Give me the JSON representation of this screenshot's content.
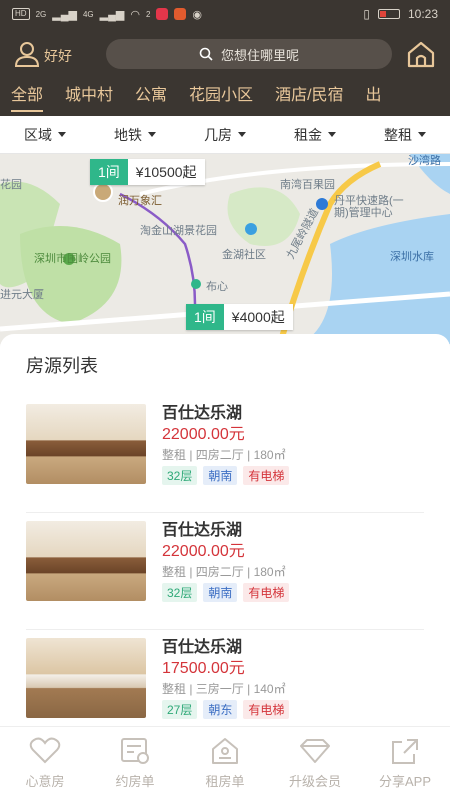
{
  "status_bar": {
    "left_chips": [
      "HD",
      "2G",
      "4G"
    ],
    "notification_count": "2",
    "time": "10:23"
  },
  "header": {
    "username": "好好",
    "search_placeholder": "您想住哪里呢",
    "icons": {
      "user": "user-icon",
      "search": "search-icon",
      "home": "home-icon"
    },
    "accent_color": "#e8c79a",
    "bg_color": "#3b3631"
  },
  "category_tabs": [
    {
      "label": "全部",
      "active": true
    },
    {
      "label": "城中村"
    },
    {
      "label": "公寓"
    },
    {
      "label": "花园小区"
    },
    {
      "label": "酒店/民宿"
    },
    {
      "label": "出"
    }
  ],
  "filters": [
    {
      "label": "区域"
    },
    {
      "label": "地铁"
    },
    {
      "label": "几房"
    },
    {
      "label": "租金"
    },
    {
      "label": "整租"
    }
  ],
  "map": {
    "labels": {
      "top_right": "沙湾路",
      "l1": "南湾百果园",
      "l2": "丹平快速路(一",
      "l3": "期)管理中心",
      "l4": "花园",
      "l5": "润万象汇",
      "l6": "淘金山湖景花园",
      "l7": "金湖社区",
      "l8": "九尾岭隧道",
      "l9": "深圳市围岭公园",
      "l10": "深圳水库",
      "l11": "布心",
      "l12": "进元大厦"
    },
    "pins": [
      {
        "rooms": "1间",
        "price": "¥10500起"
      },
      {
        "rooms": "1间",
        "price": "¥4000起"
      }
    ]
  },
  "list": {
    "title": "房源列表",
    "items": [
      {
        "name": "百仕达乐湖",
        "price": "22000.00元",
        "spec": "整租 | 四房二厅 | 180㎡",
        "tags": [
          "32层",
          "朝南",
          "有电梯"
        ]
      },
      {
        "name": "百仕达乐湖",
        "price": "22000.00元",
        "spec": "整租 | 四房二厅 | 180㎡",
        "tags": [
          "32层",
          "朝南",
          "有电梯"
        ]
      },
      {
        "name": "百仕达乐湖",
        "price": "17500.00元",
        "spec": "整租 | 三房一厅 | 140㎡",
        "tags": [
          "27层",
          "朝东",
          "有电梯"
        ]
      }
    ],
    "price_color": "#d4343a"
  },
  "bottom_nav": [
    {
      "label": "心意房",
      "icon": "heart-icon"
    },
    {
      "label": "约房单",
      "icon": "appointment-icon"
    },
    {
      "label": "租房单",
      "icon": "house-list-icon"
    },
    {
      "label": "升级会员",
      "icon": "diamond-icon"
    },
    {
      "label": "分享APP",
      "icon": "share-icon"
    }
  ]
}
